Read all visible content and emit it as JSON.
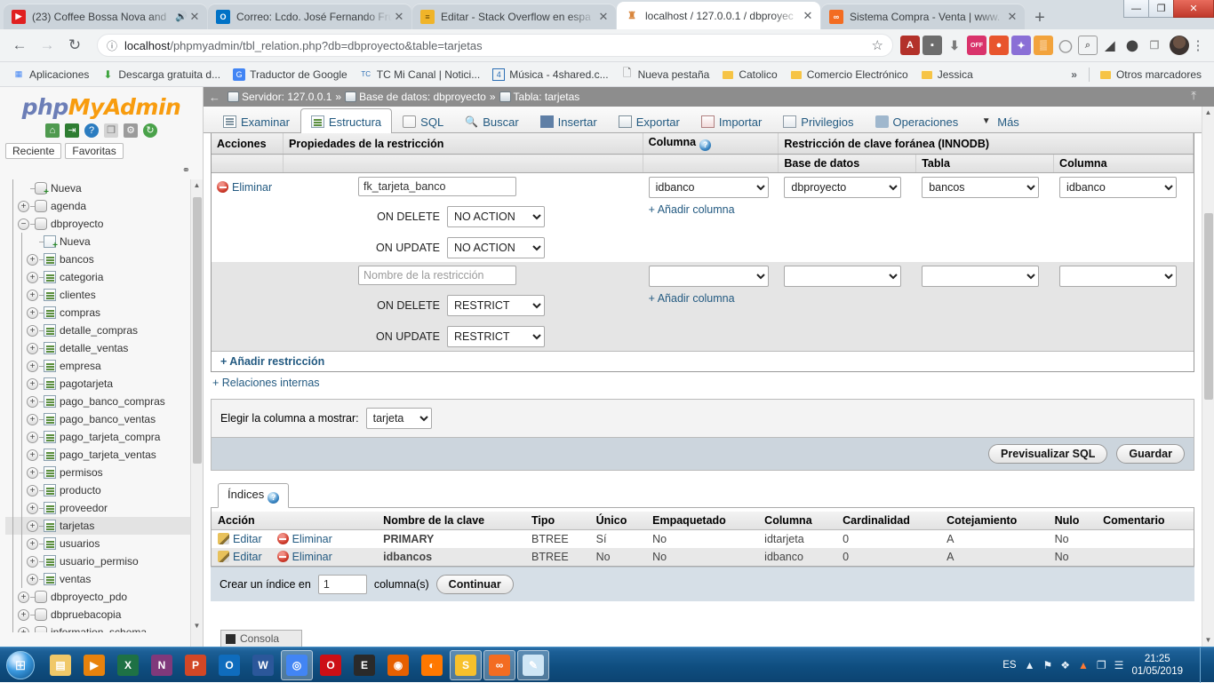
{
  "browser": {
    "tabs": [
      {
        "title": "(23) Coffee Bossa Nova and",
        "favicon": "youtube-icon",
        "color": "#e02020",
        "glyph": "▶",
        "audio": "🔊",
        "active": false
      },
      {
        "title": "Correo: Lcdo. José Fernando Fru",
        "favicon": "outlook-icon",
        "color": "#0072c6",
        "glyph": "O",
        "audio": "",
        "active": false
      },
      {
        "title": "Editar - Stack Overflow en espa",
        "favicon": "stackoverflow-icon",
        "color": "#f0b429",
        "glyph": "≡",
        "audio": "",
        "active": false
      },
      {
        "title": "localhost / 127.0.0.1 / dbproyec",
        "favicon": "phpmyadmin-icon",
        "color": "#ffffff",
        "glyph": "♟",
        "audio": "",
        "active": true
      },
      {
        "title": "Sistema Compra - Venta | www.",
        "favicon": "xampp-icon",
        "color": "#f36c21",
        "glyph": "∞",
        "audio": "",
        "active": false
      }
    ],
    "new_tab_label": "+",
    "window_controls": {
      "minimize": "—",
      "maximize": "❐",
      "close": "✕"
    },
    "nav": {
      "back": "←",
      "forward": "→",
      "reload": "↻"
    },
    "omnibox": {
      "info_icon": "ⓘ",
      "url_host": "localhost",
      "url_rest": "/phpmyadmin/tbl_relation.php?db=dbproyecto&table=tarjetas",
      "star": "☆"
    },
    "extensions": [
      {
        "name": "adobe-acrobat-icon",
        "glyph": "A",
        "color": "#b3312a"
      },
      {
        "name": "lock-bag-icon",
        "glyph": "■",
        "color": "#6d6d6d"
      },
      {
        "name": "download-arrow-icon",
        "glyph": "⬇",
        "color": "#7a7a7a"
      },
      {
        "name": "adblock-off-icon",
        "glyph": "OFF",
        "color": "#d9336b"
      },
      {
        "name": "honey-icon",
        "glyph": "●",
        "color": "#e8552d"
      },
      {
        "name": "ghostery-icon",
        "glyph": "✶",
        "color": "#8a6fd6"
      },
      {
        "name": "colorpick-icon",
        "glyph": "▒",
        "color": "#f2a33c"
      },
      {
        "name": "opera-icon",
        "glyph": "O",
        "color": "#9b9b9b"
      },
      {
        "name": "magnifier-box-icon",
        "glyph": "⌕",
        "color": "#7c7c7c"
      },
      {
        "name": "eraser-icon",
        "glyph": "◢",
        "color": "#555555"
      },
      {
        "name": "pin-icon",
        "glyph": "⬤",
        "color": "#555555"
      },
      {
        "name": "pdf-page-icon",
        "glyph": "❐",
        "color": "#9d9d9d"
      }
    ],
    "menu_dots": "⋮",
    "bookmarks": [
      {
        "label": "Aplicaciones",
        "icon": "apps-grid-icon"
      },
      {
        "label": "Descarga gratuita d...",
        "icon": "download-green-icon"
      },
      {
        "label": "Traductor de Google",
        "icon": "google-translate-icon"
      },
      {
        "label": "TC Mi Canal | Notici...",
        "icon": "tc-icon"
      },
      {
        "label": "Música - 4shared.c...",
        "icon": "4shared-icon"
      },
      {
        "label": "Nueva pestaña",
        "icon": "page-icon"
      },
      {
        "label": "Catolico",
        "icon": "folder-icon"
      },
      {
        "label": "Comercio Electrónico",
        "icon": "folder-icon"
      },
      {
        "label": "Jessica",
        "icon": "folder-icon"
      }
    ],
    "bookmarks_overflow": "»",
    "bookmarks_other": {
      "label": "Otros marcadores",
      "icon": "folder-icon"
    }
  },
  "sidebar": {
    "logo": {
      "php": "php",
      "my": "My",
      "admin": "Admin"
    },
    "quick_icons": [
      {
        "name": "home-icon",
        "glyph": "⌂",
        "color": "#3c7a3c"
      },
      {
        "name": "logout-icon",
        "glyph": "⇥",
        "color": "#2e7d32"
      },
      {
        "name": "help-icon",
        "glyph": "?",
        "color": "#2b7cc0"
      },
      {
        "name": "copy-icon",
        "glyph": "❐",
        "color": "#b9b9b9"
      },
      {
        "name": "settings-gear-icon",
        "glyph": "⚙",
        "color": "#8d8d8d"
      },
      {
        "name": "reload-icon",
        "glyph": "↻",
        "color": "#4aa24a"
      }
    ],
    "tabs": [
      {
        "label": "Reciente"
      },
      {
        "label": "Favoritas"
      }
    ],
    "chain_icon": "⚭",
    "tree": [
      {
        "label": "Nueva",
        "level": 1,
        "type": "db-new",
        "expander": "none"
      },
      {
        "label": "agenda",
        "level": 1,
        "type": "db",
        "expander": "+"
      },
      {
        "label": "dbproyecto",
        "level": 1,
        "type": "db",
        "expander": "−"
      },
      {
        "label": "Nueva",
        "level": 2,
        "type": "table-new",
        "expander": "none"
      },
      {
        "label": "bancos",
        "level": 2,
        "type": "table",
        "expander": "+"
      },
      {
        "label": "categoria",
        "level": 2,
        "type": "table",
        "expander": "+"
      },
      {
        "label": "clientes",
        "level": 2,
        "type": "table",
        "expander": "+"
      },
      {
        "label": "compras",
        "level": 2,
        "type": "table",
        "expander": "+"
      },
      {
        "label": "detalle_compras",
        "level": 2,
        "type": "table",
        "expander": "+"
      },
      {
        "label": "detalle_ventas",
        "level": 2,
        "type": "table",
        "expander": "+"
      },
      {
        "label": "empresa",
        "level": 2,
        "type": "table",
        "expander": "+"
      },
      {
        "label": "pagotarjeta",
        "level": 2,
        "type": "table",
        "expander": "+"
      },
      {
        "label": "pago_banco_compras",
        "level": 2,
        "type": "table",
        "expander": "+"
      },
      {
        "label": "pago_banco_ventas",
        "level": 2,
        "type": "table",
        "expander": "+"
      },
      {
        "label": "pago_tarjeta_compra",
        "level": 2,
        "type": "table",
        "expander": "+"
      },
      {
        "label": "pago_tarjeta_ventas",
        "level": 2,
        "type": "table",
        "expander": "+"
      },
      {
        "label": "permisos",
        "level": 2,
        "type": "table",
        "expander": "+"
      },
      {
        "label": "producto",
        "level": 2,
        "type": "table",
        "expander": "+"
      },
      {
        "label": "proveedor",
        "level": 2,
        "type": "table",
        "expander": "+"
      },
      {
        "label": "tarjetas",
        "level": 2,
        "type": "table",
        "expander": "+",
        "selected": true
      },
      {
        "label": "usuarios",
        "level": 2,
        "type": "table",
        "expander": "+"
      },
      {
        "label": "usuario_permiso",
        "level": 2,
        "type": "table",
        "expander": "+"
      },
      {
        "label": "ventas",
        "level": 2,
        "type": "table",
        "expander": "+"
      },
      {
        "label": "dbproyecto_pdo",
        "level": 1,
        "type": "db",
        "expander": "+"
      },
      {
        "label": "dbpruebacopia",
        "level": 1,
        "type": "db",
        "expander": "+"
      },
      {
        "label": "information_schema",
        "level": 1,
        "type": "db",
        "expander": "+"
      }
    ]
  },
  "breadcrumb": {
    "back_arrow": "←",
    "server_label": "Servidor: 127.0.0.1",
    "sep": "»",
    "db_label": "Base de datos: dbproyecto",
    "table_label": "Tabla: tarjetas",
    "collapse_icon": "⤒"
  },
  "page_tabs": [
    {
      "label": "Examinar",
      "icon": "grid",
      "active": false
    },
    {
      "label": "Estructura",
      "icon": "struct",
      "active": true
    },
    {
      "label": "SQL",
      "icon": "sql",
      "active": false
    },
    {
      "label": "Buscar",
      "icon": "search",
      "active": false
    },
    {
      "label": "Insertar",
      "icon": "insert",
      "active": false
    },
    {
      "label": "Exportar",
      "icon": "export",
      "active": false
    },
    {
      "label": "Importar",
      "icon": "import",
      "active": false
    },
    {
      "label": "Privilegios",
      "icon": "priv",
      "active": false
    },
    {
      "label": "Operaciones",
      "icon": "oper",
      "active": false
    },
    {
      "label": "Más",
      "icon": "more",
      "active": false
    }
  ],
  "fk_table": {
    "headers": {
      "acciones": "Acciones",
      "propiedades": "Propiedades de la restricción",
      "columna": "Columna",
      "restriccion": "Restricción de clave foránea (INNODB)",
      "base_datos": "Base de datos",
      "tabla": "Tabla",
      "columna2": "Columna"
    },
    "help_icon": "?",
    "rows": [
      {
        "action_label": "Eliminar",
        "constraint_name": "fk_tarjeta_banco",
        "constraint_placeholder": "",
        "on_delete_label": "ON DELETE",
        "on_delete_value": "NO ACTION",
        "on_update_label": "ON UPDATE",
        "on_update_value": "NO ACTION",
        "source_column": "idbanco",
        "add_column": "+ Añadir columna",
        "ref_db": "dbproyecto",
        "ref_table": "bancos",
        "ref_column": "idbanco",
        "has_action": true
      },
      {
        "action_label": "",
        "constraint_name": "",
        "constraint_placeholder": "Nombre de la restricción",
        "on_delete_label": "ON DELETE",
        "on_delete_value": "RESTRICT",
        "on_update_label": "ON UPDATE",
        "on_update_value": "RESTRICT",
        "source_column": "",
        "add_column": "+ Añadir columna",
        "ref_db": "",
        "ref_table": "",
        "ref_column": "",
        "has_action": false
      }
    ],
    "add_constraint": "+ Añadir restricción"
  },
  "internal_relations": "+ Relaciones internas",
  "show_column": {
    "label": "Elegir la columna a mostrar:",
    "value": "tarjeta"
  },
  "buttons": {
    "preview_sql": "Previsualizar SQL",
    "save": "Guardar"
  },
  "indices": {
    "panel_title": "Índices",
    "help_icon": "?",
    "headers": [
      "Acción",
      "Nombre de la clave",
      "Tipo",
      "Único",
      "Empaquetado",
      "Columna",
      "Cardinalidad",
      "Cotejamiento",
      "Nulo",
      "Comentario"
    ],
    "edit_label": "Editar",
    "delete_label": "Eliminar",
    "rows": [
      {
        "key_name": "PRIMARY",
        "type": "BTREE",
        "unique": "Sí",
        "packed": "No",
        "column": "idtarjeta",
        "cardinality": "0",
        "collation": "A",
        "null": "No",
        "comment": ""
      },
      {
        "key_name": "idbancos",
        "type": "BTREE",
        "unique": "No",
        "packed": "No",
        "column": "idbanco",
        "cardinality": "0",
        "collation": "A",
        "null": "No",
        "comment": ""
      }
    ],
    "create_index": {
      "prefix": "Crear un índice en",
      "value": "1",
      "suffix": "columna(s)",
      "button": "Continuar"
    }
  },
  "console": {
    "label": "Consola"
  },
  "taskbar": {
    "start_glyph": "⊞",
    "items": [
      {
        "name": "file-explorer-icon",
        "glyph": "▤",
        "color": "#f0c869",
        "active": false
      },
      {
        "name": "media-player-icon",
        "glyph": "▶",
        "color": "#e8820c",
        "active": false
      },
      {
        "name": "excel-icon",
        "glyph": "X",
        "color": "#1e7145",
        "active": false
      },
      {
        "name": "onenote-icon",
        "glyph": "N",
        "color": "#80397b",
        "active": false
      },
      {
        "name": "powerpoint-icon",
        "glyph": "P",
        "color": "#d24726",
        "active": false
      },
      {
        "name": "outlook-icon",
        "glyph": "O",
        "color": "#0f6cbd",
        "active": false
      },
      {
        "name": "word-icon",
        "glyph": "W",
        "color": "#2b579a",
        "active": false
      },
      {
        "name": "chrome-icon",
        "glyph": "◎",
        "color": "#4285f4",
        "active": true
      },
      {
        "name": "opera-icon",
        "glyph": "O",
        "color": "#cc0f16",
        "active": false
      },
      {
        "name": "epic-games-icon",
        "glyph": "E",
        "color": "#2a2a2a",
        "active": false
      },
      {
        "name": "firefox-icon",
        "glyph": "◉",
        "color": "#e66000",
        "active": false
      },
      {
        "name": "avast-icon",
        "glyph": "◐",
        "color": "#ff7800",
        "active": false
      },
      {
        "name": "sublime-text-icon",
        "glyph": "S",
        "color": "#f7c02c",
        "active": true
      },
      {
        "name": "xampp-icon",
        "glyph": "∞",
        "color": "#f36c21",
        "active": true
      },
      {
        "name": "paint-icon",
        "glyph": "✎",
        "color": "#cfe6f5",
        "active": true
      }
    ],
    "language": "ES",
    "tray_icons": [
      {
        "name": "show-hidden-icons",
        "glyph": "▲"
      },
      {
        "name": "network-flag-icon",
        "glyph": "⚑"
      },
      {
        "name": "dropbox-icon",
        "glyph": "❖"
      },
      {
        "name": "avast-tray-icon",
        "glyph": "▲"
      },
      {
        "name": "clipboard-icon",
        "glyph": "❐"
      },
      {
        "name": "network-icon",
        "glyph": "☰"
      }
    ],
    "time": "21:25",
    "date": "01/05/2019"
  }
}
